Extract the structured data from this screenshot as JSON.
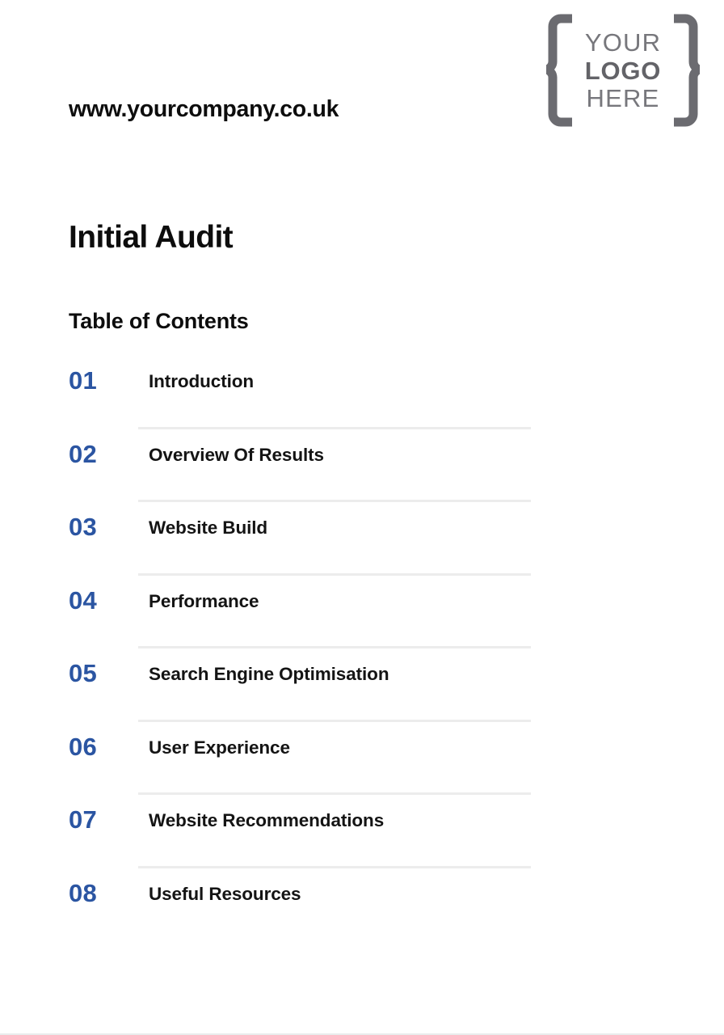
{
  "header": {
    "site_url": "www.yourcompany.co.uk",
    "logo": {
      "line1": "YOUR",
      "line2": "LOGO",
      "line3": "HERE",
      "color": "#6b6b70"
    }
  },
  "document": {
    "title": "Initial Audit",
    "toc_heading": "Table of Contents"
  },
  "toc": {
    "accent_color": "#2b55a2",
    "divider_color": "#ececec",
    "items": [
      {
        "number": "01",
        "label": "Introduction"
      },
      {
        "number": "02",
        "label": "Overview Of Results"
      },
      {
        "number": "03",
        "label": "Website Build"
      },
      {
        "number": "04",
        "label": "Performance"
      },
      {
        "number": "05",
        "label": "Search Engine Optimisation"
      },
      {
        "number": "06",
        "label": "User Experience"
      },
      {
        "number": "07",
        "label": "Website Recommendations"
      },
      {
        "number": "08",
        "label": "Useful Resources"
      }
    ]
  }
}
